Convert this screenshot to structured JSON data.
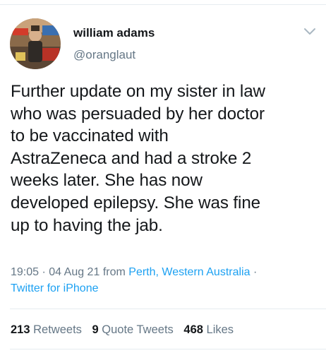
{
  "user": {
    "display_name": "william adams",
    "handle": "@oranglaut"
  },
  "tweet": {
    "text": "Further update on my sister in law\nwho was persuaded  by her doctor\nto be vaccinated with\nAstraZeneca and had a stroke 2\nweeks later. She has now\ndeveloped epilepsy. She was fine\nup to having the jab.",
    "time": "19:05",
    "date": "04 Aug 21",
    "from_label": "from",
    "location": "Perth, Western Australia",
    "client": "Twitter for iPhone"
  },
  "stats": {
    "retweets_count": "213",
    "retweets_label": "Retweets",
    "quotes_count": "9",
    "quotes_label": "Quote Tweets",
    "likes_count": "468",
    "likes_label": "Likes"
  },
  "icons": {
    "menu": "chevron-down-icon",
    "avatar": "profile-photo"
  },
  "colors": {
    "link": "#1da1f2",
    "secondary_text": "#657786",
    "primary_text": "#14171a",
    "divider": "#e6ecf0"
  }
}
